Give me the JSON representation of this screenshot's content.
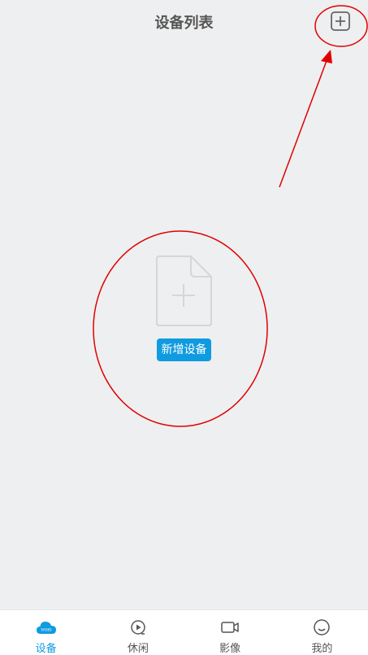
{
  "header": {
    "title": "设备列表",
    "add_icon": "plus-square-icon"
  },
  "empty_state": {
    "icon": "document-plus-icon",
    "button_label": "新增设备"
  },
  "tabbar": {
    "active_color": "#0f9be0",
    "tabs": [
      {
        "label": "设备",
        "icon": "cloud-icon",
        "active": true
      },
      {
        "label": "休闲",
        "icon": "play-circle-icon",
        "active": false
      },
      {
        "label": "影像",
        "icon": "video-camera-icon",
        "active": false
      },
      {
        "label": "我的",
        "icon": "smiley-icon",
        "active": false
      }
    ]
  },
  "annotation_color": "#e00000"
}
